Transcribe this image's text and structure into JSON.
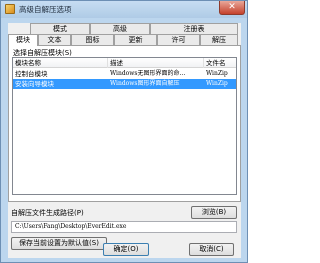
{
  "window": {
    "title": "高级自解压选项",
    "close": "✕"
  },
  "tabs_row1": [
    {
      "label": "模式"
    },
    {
      "label": "高级"
    },
    {
      "label": "注册表"
    }
  ],
  "tabs_row2": [
    {
      "label": "模块"
    },
    {
      "label": "文本"
    },
    {
      "label": "图标"
    },
    {
      "label": "更新"
    },
    {
      "label": "许可"
    },
    {
      "label": "解压"
    }
  ],
  "panel": {
    "label": "选择自解压模块(S)"
  },
  "modules_table": {
    "columns": [
      "模块名称",
      "描述",
      "文件名"
    ],
    "rows": [
      {
        "name": "控制台模块",
        "description": "Windows无图形界面的命...",
        "file": "WinZip"
      },
      {
        "name": "安装向导模块",
        "description": "Windows图形界面自解压",
        "file": "WinZip"
      }
    ],
    "selected_index": 1
  },
  "path": {
    "label": "自解压文件生成路径(P)",
    "browse_button": "浏览(B)",
    "value": "C:\\Users\\Fang\\Desktop\\EverEdit.exe"
  },
  "save_default_button": "保存当前设置为默认值(S)",
  "footer": {
    "ok": "确定(O)",
    "cancel": "取消(C)"
  }
}
